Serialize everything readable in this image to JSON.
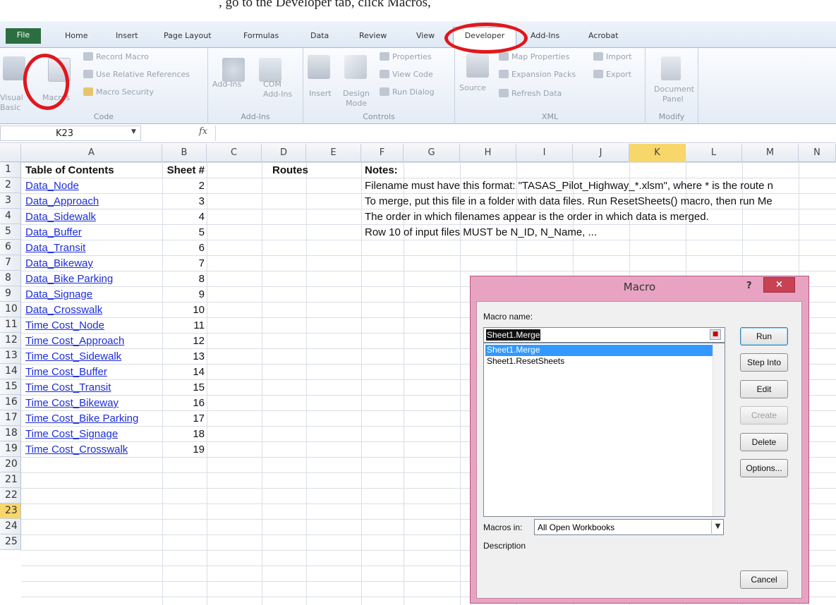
{
  "caption": ", go to the Developer tab, click Macros,",
  "ribbon": {
    "tabs": [
      "File",
      "Home",
      "Insert",
      "Page Layout",
      "Formulas",
      "Data",
      "Review",
      "View",
      "Developer",
      "Add-Ins",
      "Acrobat"
    ],
    "code_group": {
      "label": "Code",
      "visual_basic_line1": "Visual",
      "visual_basic_line2": "Basic",
      "macros": "Macros",
      "record_macro": "Record Macro",
      "use_relative": "Use Relative References",
      "macro_security": "Macro Security"
    },
    "addins_group": {
      "label": "Add-Ins",
      "addins": "Add-Ins",
      "com_line1": "COM",
      "com_line2": "Add-Ins"
    },
    "controls_group": {
      "label": "Controls",
      "insert": "Insert",
      "design_line1": "Design",
      "design_line2": "Mode",
      "properties": "Properties",
      "view_code": "View Code",
      "run_dialog": "Run Dialog"
    },
    "xml_group": {
      "label": "XML",
      "source": "Source",
      "map_properties": "Map Properties",
      "expansion_packs": "Expansion Packs",
      "refresh_data": "Refresh Data",
      "import": "Import",
      "export": "Export"
    },
    "modify_group": {
      "label": "Modify",
      "doc_line1": "Document",
      "doc_line2": "Panel"
    }
  },
  "formula_bar": {
    "name_box": "K23",
    "fx": "fx",
    "formula": ""
  },
  "columns": [
    "A",
    "B",
    "C",
    "D",
    "E",
    "F",
    "G",
    "H",
    "I",
    "J",
    "K",
    "L",
    "M",
    "N"
  ],
  "selected_column": "K",
  "selected_row": 23,
  "rows": [
    "1",
    "2",
    "3",
    "4",
    "5",
    "6",
    "7",
    "8",
    "9",
    "10",
    "11",
    "12",
    "13",
    "14",
    "15",
    "16",
    "17",
    "18",
    "19",
    "20",
    "21",
    "22",
    "23",
    "24",
    "25"
  ],
  "header_row": {
    "a": "Table of Contents",
    "b": "Sheet #",
    "d": "Routes",
    "f": "Notes:"
  },
  "toc": [
    {
      "name": "Data_Node",
      "sheet": "2"
    },
    {
      "name": "Data_Approach",
      "sheet": "3"
    },
    {
      "name": "Data_Sidewalk",
      "sheet": "4"
    },
    {
      "name": "Data_Buffer",
      "sheet": "5"
    },
    {
      "name": "Data_Transit",
      "sheet": "6"
    },
    {
      "name": "Data_Bikeway",
      "sheet": "7"
    },
    {
      "name": "Data_Bike Parking",
      "sheet": "8"
    },
    {
      "name": "Data_Signage",
      "sheet": "9"
    },
    {
      "name": "Data_Crosswalk",
      "sheet": "10"
    },
    {
      "name": "Time Cost_Node",
      "sheet": "11"
    },
    {
      "name": "Time Cost_Approach",
      "sheet": "12"
    },
    {
      "name": "Time Cost_Sidewalk",
      "sheet": "13"
    },
    {
      "name": "Time Cost_Buffer",
      "sheet": "14"
    },
    {
      "name": "Time Cost_Transit",
      "sheet": "15"
    },
    {
      "name": "Time Cost_Bikeway",
      "sheet": "16"
    },
    {
      "name": "Time Cost_Bike Parking",
      "sheet": "17"
    },
    {
      "name": "Time Cost_Signage",
      "sheet": "18"
    },
    {
      "name": "Time Cost_Crosswalk",
      "sheet": "19"
    }
  ],
  "notes": [
    "Filename must have this format: \"TASAS_Pilot_Highway_*.xlsm\", where * is the route n",
    "To merge, put this file in a folder with data files. Run ResetSheets() macro, then run Me",
    "The order in which filenames appear is the order in which data is merged.",
    "Row 10 of input files MUST be N_ID, N_Name, ..."
  ],
  "dialog": {
    "title": "Macro",
    "help": "?",
    "close": "×",
    "macro_name_label": "Macro name:",
    "macro_name_value": "Sheet1.Merge",
    "macros": [
      "Sheet1.Merge",
      "Sheet1.ResetSheets"
    ],
    "buttons": {
      "run": "Run",
      "step_into": "Step Into",
      "edit": "Edit",
      "create": "Create",
      "delete": "Delete",
      "options": "Options...",
      "cancel": "Cancel"
    },
    "macros_in_label": "Macros in:",
    "macros_in_value": "All Open Workbooks",
    "description_label": "Description"
  },
  "colors": {
    "annotation_red": "#e0171d",
    "link_blue": "#1d2ed8",
    "dialog_frame": "#e8a3c3",
    "selection_blue": "#3399ff"
  }
}
